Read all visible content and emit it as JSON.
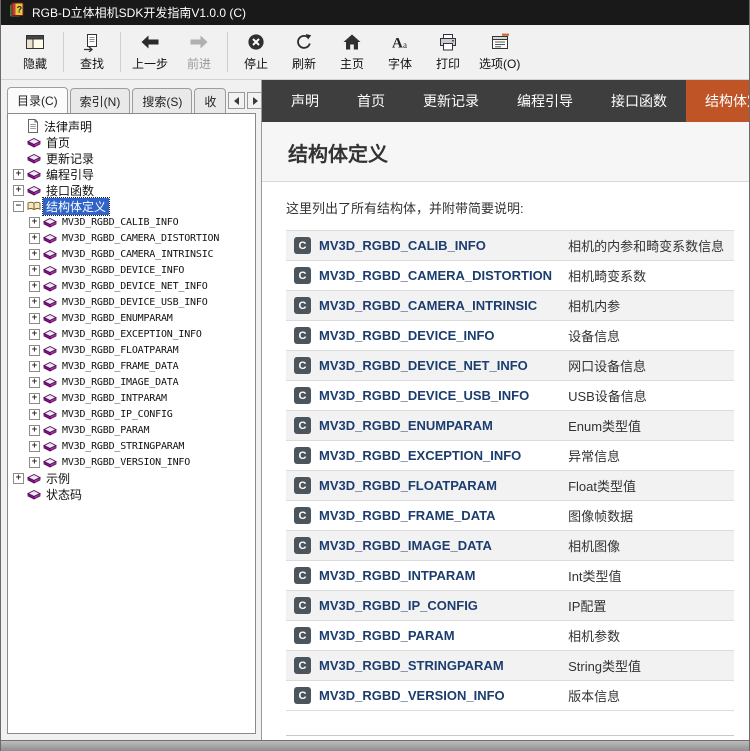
{
  "window": {
    "title": "RGB-D立体相机SDK开发指南V1.0.0  (C)"
  },
  "toolbar": {
    "buttons": [
      {
        "id": "hide",
        "label": "隐藏",
        "icon": "hide-icon",
        "disabled": false,
        "separator_after": true
      },
      {
        "id": "locate",
        "label": "查找",
        "icon": "locate-icon",
        "disabled": false,
        "separator_after": true
      },
      {
        "id": "back",
        "label": "上一步",
        "icon": "back-icon",
        "disabled": false,
        "separator_after": false
      },
      {
        "id": "forward",
        "label": "前进",
        "icon": "forward-icon",
        "disabled": true,
        "separator_after": true
      },
      {
        "id": "stop",
        "label": "停止",
        "icon": "stop-icon",
        "disabled": false,
        "separator_after": false
      },
      {
        "id": "refresh",
        "label": "刷新",
        "icon": "refresh-icon",
        "disabled": false,
        "separator_after": false
      },
      {
        "id": "home",
        "label": "主页",
        "icon": "home-icon",
        "disabled": false,
        "separator_after": false
      },
      {
        "id": "font",
        "label": "字体",
        "icon": "font-icon",
        "disabled": false,
        "separator_after": false
      },
      {
        "id": "print",
        "label": "打印",
        "icon": "print-icon",
        "disabled": false,
        "separator_after": false
      },
      {
        "id": "options",
        "label": "选项(O)",
        "icon": "options-icon",
        "disabled": false,
        "separator_after": false
      }
    ]
  },
  "sidebar": {
    "tabs": [
      {
        "id": "contents",
        "label": "目录(C)",
        "active": true
      },
      {
        "id": "index",
        "label": "索引(N)",
        "active": false
      },
      {
        "id": "search",
        "label": "搜索(S)",
        "active": false
      },
      {
        "id": "favorites",
        "label": "收",
        "active": false
      }
    ],
    "tree": [
      {
        "label": "法律声明",
        "level": 0,
        "expander": "none",
        "icon": "document-icon",
        "selected": false,
        "mono": false
      },
      {
        "label": "首页",
        "level": 0,
        "expander": "none",
        "icon": "book-icon",
        "selected": false,
        "mono": false
      },
      {
        "label": "更新记录",
        "level": 0,
        "expander": "none",
        "icon": "book-icon",
        "selected": false,
        "mono": false
      },
      {
        "label": "编程引导",
        "level": 0,
        "expander": "plus",
        "icon": "book-icon",
        "selected": false,
        "mono": false
      },
      {
        "label": "接口函数",
        "level": 0,
        "expander": "plus",
        "icon": "book-icon",
        "selected": false,
        "mono": false
      },
      {
        "label": "结构体定义",
        "level": 0,
        "expander": "minus",
        "icon": "open-book-icon",
        "selected": true,
        "mono": false
      },
      {
        "label": "MV3D_RGBD_CALIB_INFO",
        "level": 1,
        "expander": "plus",
        "icon": "book-icon",
        "selected": false,
        "mono": true
      },
      {
        "label": "MV3D_RGBD_CAMERA_DISTORTION",
        "level": 1,
        "expander": "plus",
        "icon": "book-icon",
        "selected": false,
        "mono": true
      },
      {
        "label": "MV3D_RGBD_CAMERA_INTRINSIC",
        "level": 1,
        "expander": "plus",
        "icon": "book-icon",
        "selected": false,
        "mono": true
      },
      {
        "label": "MV3D_RGBD_DEVICE_INFO",
        "level": 1,
        "expander": "plus",
        "icon": "book-icon",
        "selected": false,
        "mono": true
      },
      {
        "label": "MV3D_RGBD_DEVICE_NET_INFO",
        "level": 1,
        "expander": "plus",
        "icon": "book-icon",
        "selected": false,
        "mono": true
      },
      {
        "label": "MV3D_RGBD_DEVICE_USB_INFO",
        "level": 1,
        "expander": "plus",
        "icon": "book-icon",
        "selected": false,
        "mono": true
      },
      {
        "label": "MV3D_RGBD_ENUMPARAM",
        "level": 1,
        "expander": "plus",
        "icon": "book-icon",
        "selected": false,
        "mono": true
      },
      {
        "label": "MV3D_RGBD_EXCEPTION_INFO",
        "level": 1,
        "expander": "plus",
        "icon": "book-icon",
        "selected": false,
        "mono": true
      },
      {
        "label": "MV3D_RGBD_FLOATPARAM",
        "level": 1,
        "expander": "plus",
        "icon": "book-icon",
        "selected": false,
        "mono": true
      },
      {
        "label": "MV3D_RGBD_FRAME_DATA",
        "level": 1,
        "expander": "plus",
        "icon": "book-icon",
        "selected": false,
        "mono": true
      },
      {
        "label": "MV3D_RGBD_IMAGE_DATA",
        "level": 1,
        "expander": "plus",
        "icon": "book-icon",
        "selected": false,
        "mono": true
      },
      {
        "label": "MV3D_RGBD_INTPARAM",
        "level": 1,
        "expander": "plus",
        "icon": "book-icon",
        "selected": false,
        "mono": true
      },
      {
        "label": "MV3D_RGBD_IP_CONFIG",
        "level": 1,
        "expander": "plus",
        "icon": "book-icon",
        "selected": false,
        "mono": true
      },
      {
        "label": "MV3D_RGBD_PARAM",
        "level": 1,
        "expander": "plus",
        "icon": "book-icon",
        "selected": false,
        "mono": true
      },
      {
        "label": "MV3D_RGBD_STRINGPARAM",
        "level": 1,
        "expander": "plus",
        "icon": "book-icon",
        "selected": false,
        "mono": true
      },
      {
        "label": "MV3D_RGBD_VERSION_INFO",
        "level": 1,
        "expander": "plus",
        "icon": "book-icon",
        "selected": false,
        "mono": true
      },
      {
        "label": "示例",
        "level": 0,
        "expander": "plus",
        "icon": "book-icon",
        "selected": false,
        "mono": false
      },
      {
        "label": "状态码",
        "level": 0,
        "expander": "none",
        "icon": "book-icon",
        "selected": false,
        "mono": false
      }
    ]
  },
  "content": {
    "nav": [
      {
        "label": "声明",
        "active": false
      },
      {
        "label": "首页",
        "active": false
      },
      {
        "label": "更新记录",
        "active": false
      },
      {
        "label": "编程引导",
        "active": false
      },
      {
        "label": "接口函数",
        "active": false
      },
      {
        "label": "结构体定义",
        "active": true
      }
    ],
    "page_title": "结构体定义",
    "intro": "这里列出了所有结构体，并附带简要说明:",
    "struct_table": {
      "badge": "C",
      "rows": [
        {
          "name": "MV3D_RGBD_CALIB_INFO",
          "desc": "相机的内参和畸变系数信息"
        },
        {
          "name": "MV3D_RGBD_CAMERA_DISTORTION",
          "desc": "相机畸变系数"
        },
        {
          "name": "MV3D_RGBD_CAMERA_INTRINSIC",
          "desc": "相机内参"
        },
        {
          "name": "MV3D_RGBD_DEVICE_INFO",
          "desc": "设备信息"
        },
        {
          "name": "MV3D_RGBD_DEVICE_NET_INFO",
          "desc": "网口设备信息"
        },
        {
          "name": "MV3D_RGBD_DEVICE_USB_INFO",
          "desc": "USB设备信息"
        },
        {
          "name": "MV3D_RGBD_ENUMPARAM",
          "desc": "Enum类型值"
        },
        {
          "name": "MV3D_RGBD_EXCEPTION_INFO",
          "desc": "异常信息"
        },
        {
          "name": "MV3D_RGBD_FLOATPARAM",
          "desc": "Float类型值"
        },
        {
          "name": "MV3D_RGBD_FRAME_DATA",
          "desc": "图像帧数据"
        },
        {
          "name": "MV3D_RGBD_IMAGE_DATA",
          "desc": "相机图像"
        },
        {
          "name": "MV3D_RGBD_INTPARAM",
          "desc": "Int类型值"
        },
        {
          "name": "MV3D_RGBD_IP_CONFIG",
          "desc": "IP配置"
        },
        {
          "name": "MV3D_RGBD_PARAM",
          "desc": "相机参数"
        },
        {
          "name": "MV3D_RGBD_STRINGPARAM",
          "desc": "String类型值"
        },
        {
          "name": "MV3D_RGBD_VERSION_INFO",
          "desc": "版本信息"
        }
      ]
    }
  },
  "colors": {
    "titlebar_bg": "#191919",
    "toolbar_bg": "#f1f1f1",
    "nav_bg": "#3e3e3e",
    "nav_active_bg": "#bf5426",
    "selection_bg": "#2f63c9",
    "link_color": "#1c3d6e",
    "badge_bg": "#4c545c",
    "row_alt_bg": "#f2f2f2",
    "book_color": "#c426c4"
  }
}
